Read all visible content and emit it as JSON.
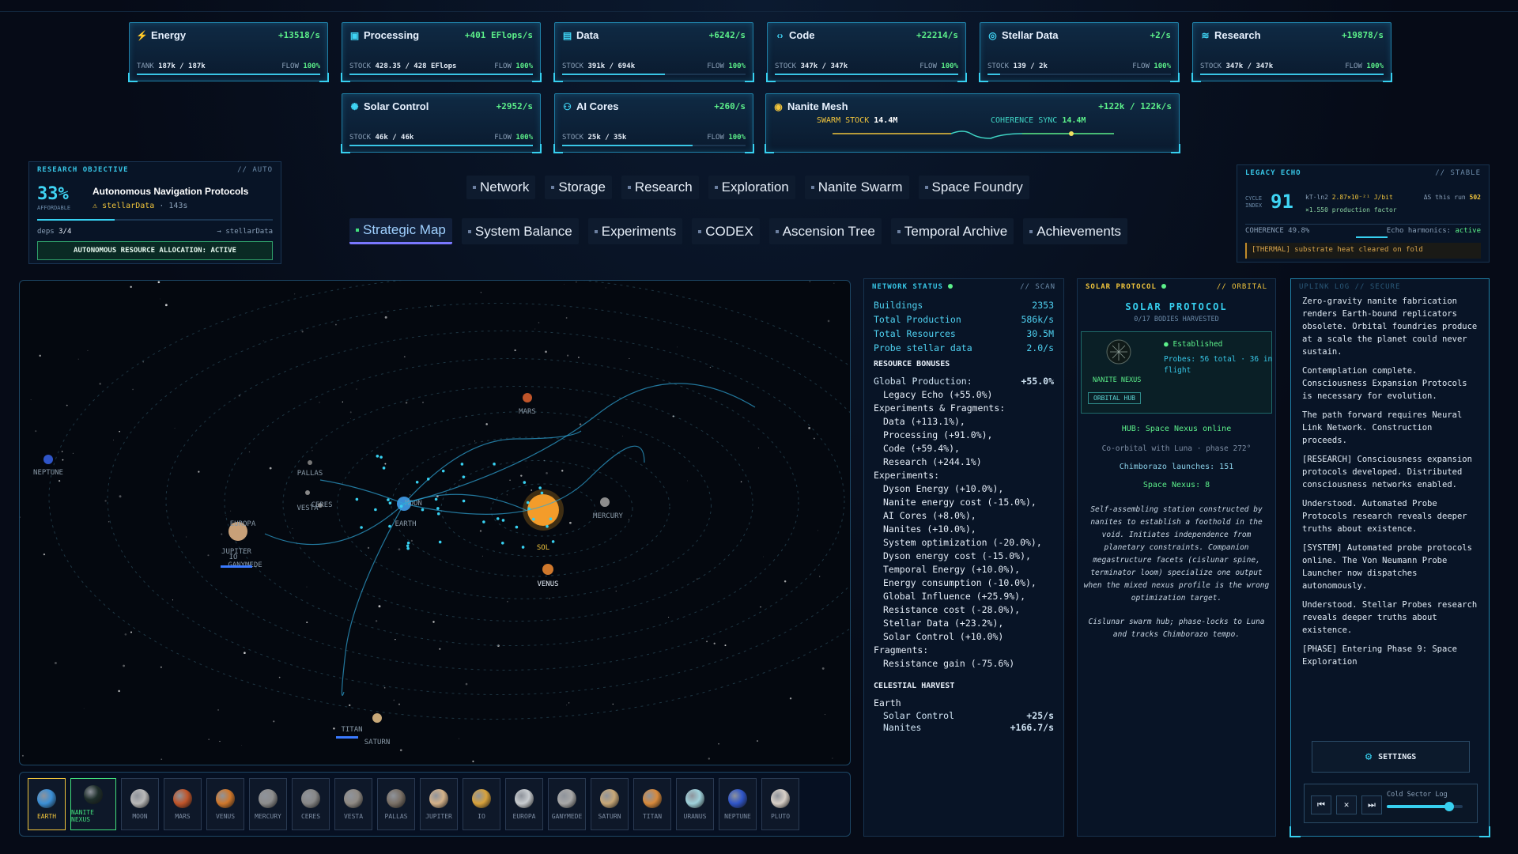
{
  "resources": [
    {
      "name": "Energy",
      "icon": "bolt-icon",
      "glyph": "⚡",
      "rate": "+13518/s",
      "stock_label": "TANK",
      "stock": "187k / 187k",
      "flow": "100%",
      "fill": 1.0
    },
    {
      "name": "Processing",
      "icon": "chip-icon",
      "glyph": "▣",
      "rate": "+401 EFlops/s",
      "stock_label": "STOCK",
      "stock": "428.35 / 428 EFlops",
      "flow": "100%",
      "fill": 1.0
    },
    {
      "name": "Data",
      "icon": "database-icon",
      "glyph": "▤",
      "rate": "+6242/s",
      "stock_label": "STOCK",
      "stock": "391k / 694k",
      "flow": "100%",
      "fill": 0.56
    },
    {
      "name": "Code",
      "icon": "code-icon",
      "glyph": "‹›",
      "rate": "+22214/s",
      "stock_label": "STOCK",
      "stock": "347k / 347k",
      "flow": "100%",
      "fill": 1.0
    },
    {
      "name": "Stellar Data",
      "icon": "globe-icon",
      "glyph": "◎",
      "rate": "+2/s",
      "stock_label": "STOCK",
      "stock": "139 / 2k",
      "flow": "100%",
      "fill": 0.07
    },
    {
      "name": "Research",
      "icon": "layers-icon",
      "glyph": "≋",
      "rate": "+19878/s",
      "stock_label": "STOCK",
      "stock": "347k / 347k",
      "flow": "100%",
      "fill": 1.0
    },
    {
      "name": "Solar Control",
      "icon": "sun-icon",
      "glyph": "✺",
      "rate": "+2952/s",
      "stock_label": "STOCK",
      "stock": "46k / 46k",
      "flow": "100%",
      "fill": 1.0
    },
    {
      "name": "AI Cores",
      "icon": "brain-icon",
      "glyph": "⚇",
      "rate": "+260/s",
      "stock_label": "STOCK",
      "stock": "25k / 35k",
      "flow": "100%",
      "fill": 0.71
    }
  ],
  "nanite": {
    "name": "Nanite Mesh",
    "icon": "swarm-icon",
    "glyph": "◉",
    "rate": "+122k / 122k/s",
    "swarm_label": "SWARM STOCK",
    "swarm": "14.4M",
    "coherence_label": "COHERENCE SYNC",
    "coherence": "14.4M"
  },
  "research": {
    "title": "RESEARCH OBJECTIVE",
    "mode": "// AUTO",
    "percent": "33%",
    "affordable": "AFFORDABLE",
    "name": "Autonomous Navigation Protocols",
    "req": "stellarData",
    "time": "· 143s",
    "deps_label": "deps",
    "deps": "3/4",
    "target": "→ stellarData",
    "progress": 0.33,
    "alloc": "AUTONOMOUS RESOURCE ALLOCATION: ACTIVE"
  },
  "nav": {
    "row1": [
      "Network",
      "Storage",
      "Research",
      "Exploration",
      "Nanite Swarm",
      "Space Foundry"
    ],
    "row2": [
      "Strategic Map",
      "System Balance",
      "Experiments",
      "CODEX",
      "Ascension Tree",
      "Temporal Archive",
      "Achievements"
    ]
  },
  "legacy": {
    "title": "LEGACY ECHO",
    "status": "// STABLE",
    "cycle_label": "CYCLE INDEX",
    "cycle": "91",
    "kt": "kT·ln2",
    "kt_val": "2.87×10⁻²¹ J/bit",
    "factor": "×1.550 production factor",
    "delta_label": "ΔS this run",
    "delta": "502",
    "coherence": "COHERENCE 49.8%",
    "harmonics_label": "Echo harmonics:",
    "harmonics": "active",
    "thermal": "[THERMAL] substrate heat cleared on fold"
  },
  "map": {
    "labels": [
      "NEPTUNE",
      "MARS",
      "PALLAS",
      "VESTA",
      "CERES",
      "EUROPA",
      "JUPITER",
      "IO",
      "GANYMEDE",
      "EARTH",
      "MOON",
      "SOL",
      "MERCURY",
      "VENUS",
      "TITAN",
      "SATURN"
    ]
  },
  "network": {
    "title": "NETWORK STATUS",
    "tag": "// SCAN",
    "stats": [
      [
        "Buildings",
        "2353"
      ],
      [
        "Total Production",
        "586k/s"
      ],
      [
        "Total Resources",
        "30.5M"
      ],
      [
        "Probe stellar data",
        "2.0/s"
      ]
    ],
    "bonus_title": "RESOURCE BONUSES",
    "global_label": "Global Production:",
    "global_val": "+55.0%",
    "lines": [
      {
        "t": "Legacy Echo (+55.0%)",
        "i": 1
      },
      {
        "t": "Experiments & Fragments:",
        "i": 0
      },
      {
        "t": "Data (+113.1%),",
        "i": 1
      },
      {
        "t": "Processing (+91.0%),",
        "i": 1
      },
      {
        "t": "Code (+59.4%),",
        "i": 1
      },
      {
        "t": "Research (+244.1%)",
        "i": 1
      },
      {
        "t": "Experiments:",
        "i": 0
      },
      {
        "t": "Dyson Energy (+10.0%),",
        "i": 1
      },
      {
        "t": "Nanite energy cost (-15.0%),",
        "i": 1
      },
      {
        "t": "AI Cores (+8.0%),",
        "i": 1
      },
      {
        "t": "Nanites (+10.0%),",
        "i": 1
      },
      {
        "t": "System optimization (-20.0%),",
        "i": 1
      },
      {
        "t": "Dyson energy cost (-15.0%),",
        "i": 1
      },
      {
        "t": "Temporal Energy (+10.0%),",
        "i": 1
      },
      {
        "t": "Energy consumption (-10.0%),",
        "i": 1
      },
      {
        "t": "Global Influence (+25.9%),",
        "i": 1
      },
      {
        "t": "Resistance cost (-28.0%),",
        "i": 1
      },
      {
        "t": "Stellar Data (+23.2%),",
        "i": 1
      },
      {
        "t": "Solar Control (+10.0%)",
        "i": 1
      },
      {
        "t": "Fragments:",
        "i": 0
      },
      {
        "t": "Resistance gain (-75.6%)",
        "i": 1
      }
    ],
    "harvest_title": "CELESTIAL HARVEST",
    "harvest_body": "Earth",
    "harvest": [
      [
        "Solar Control",
        "+25/s"
      ],
      [
        "Nanites",
        "+166.7/s"
      ]
    ]
  },
  "solar": {
    "title": "SOLAR PROTOCOL",
    "tag": "// ORBITAL",
    "heading": "SOLAR PROTOCOL",
    "bodies": "0/17 BODIES HARVESTED",
    "established": "Established",
    "probes": "Probes: 56 total · 36 in flight",
    "nexus": "NANITE NEXUS",
    "hub_badge": "ORBITAL HUB",
    "hub": "HUB: Space Nexus online",
    "coorbital": "Co-orbital with Luna · phase 272°",
    "launches": "Chimborazo launches: 151",
    "nexus_count": "Space Nexus: 8",
    "desc": "Self-assembling station constructed by nanites to establish a foothold in the void. Initiates independence from planetary constraints. Companion megastructure facets (cislunar spine, terminator loom) specialize one output when the mixed nexus profile is the wrong optimization target.",
    "desc2": "Cislunar swarm hub; phase-locks to Luna and tracks Chimborazo tempo."
  },
  "log": {
    "title": "UPLINK LOG // SECURE",
    "entries": [
      "Zero-gravity nanite fabrication renders Earth-bound replicators obsolete. Orbital foundries produce at a scale the planet could never sustain.",
      "Contemplation complete. Consciousness Expansion Protocols is necessary for evolution.",
      "The path forward requires Neural Link Network. Construction proceeds.",
      "[RESEARCH] Consciousness expansion protocols developed. Distributed consciousness networks enabled.",
      "Understood. Automated Probe Protocols research reveals deeper truths about existence.",
      "[SYSTEM] Automated probe protocols online. The Von Neumann Probe Launcher now dispatches autonomously.",
      "Understood. Stellar Probes research reveals deeper truths about existence.",
      "[PHASE] Entering Phase 9: Space Exploration"
    ],
    "settings": "SETTINGS",
    "track": "Cold Sector Log",
    "volume": 0.82
  },
  "bodies": [
    {
      "n": "EARTH",
      "c": "#3b8fd6"
    },
    {
      "n": "NANITE NEXUS",
      "c": "#1e2e2a"
    },
    {
      "n": "MOON",
      "c": "#b9b9b9"
    },
    {
      "n": "MARS",
      "c": "#c0552a"
    },
    {
      "n": "VENUS",
      "c": "#d0782c"
    },
    {
      "n": "MERCURY",
      "c": "#8d8d8d"
    },
    {
      "n": "CERES",
      "c": "#888888"
    },
    {
      "n": "VESTA",
      "c": "#8f8a84"
    },
    {
      "n": "PALLAS",
      "c": "#7a7066"
    },
    {
      "n": "JUPITER",
      "c": "#d4b28a"
    },
    {
      "n": "IO",
      "c": "#d8a23c"
    },
    {
      "n": "EUROPA",
      "c": "#c8ccd0"
    },
    {
      "n": "GANYMEDE",
      "c": "#a8a8a8"
    },
    {
      "n": "SATURN",
      "c": "#c8a878"
    },
    {
      "n": "TITAN",
      "c": "#d88a3c"
    },
    {
      "n": "URANUS",
      "c": "#9fd2dc"
    },
    {
      "n": "NEPTUNE",
      "c": "#2f55c8"
    },
    {
      "n": "PLUTO",
      "c": "#d8d0c8"
    }
  ],
  "colors": {
    "accent": "#37d0f0",
    "green": "#5cf08a",
    "gold": "#f0c43c"
  }
}
